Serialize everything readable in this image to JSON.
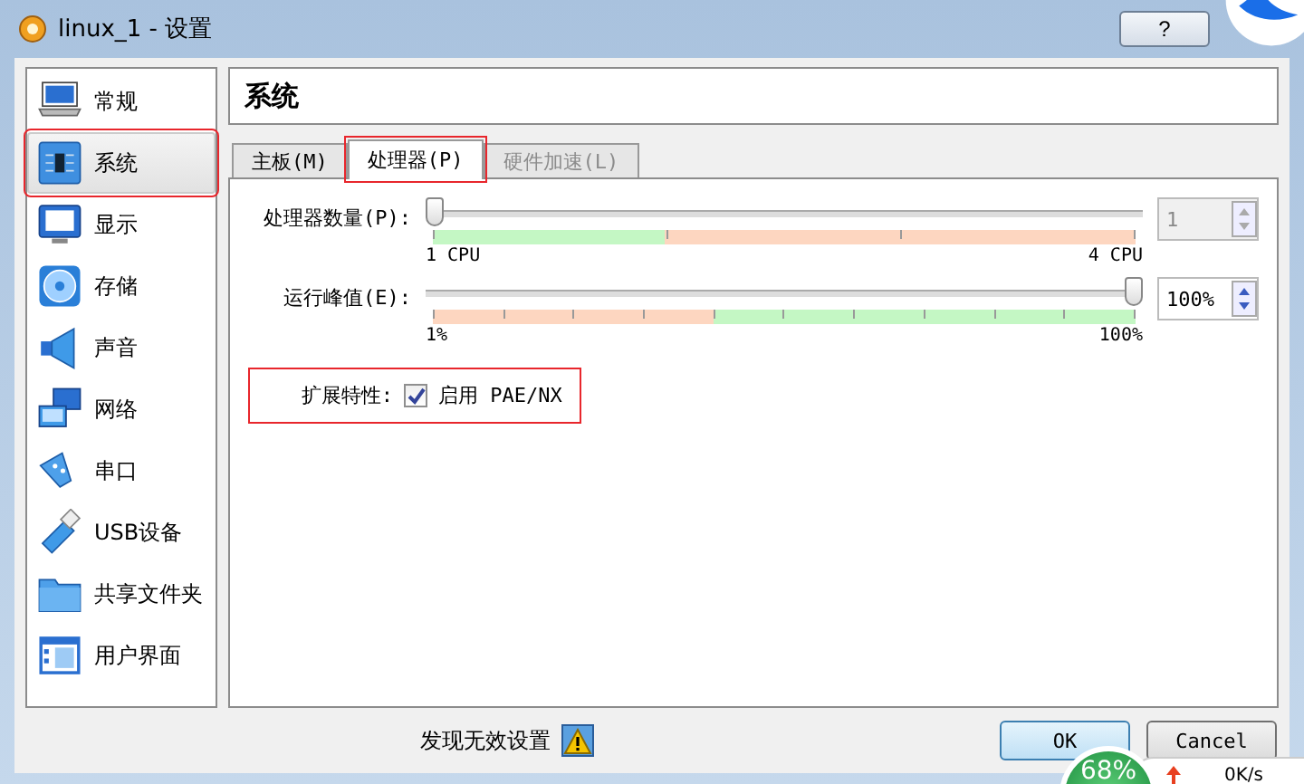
{
  "window": {
    "title": "linux_1 - 设置",
    "help": "?"
  },
  "sidebar": {
    "items": [
      {
        "label": "常规",
        "selected": false,
        "highlighted": false
      },
      {
        "label": "系统",
        "selected": true,
        "highlighted": true
      },
      {
        "label": "显示",
        "selected": false,
        "highlighted": false
      },
      {
        "label": "存储",
        "selected": false,
        "highlighted": false
      },
      {
        "label": "声音",
        "selected": false,
        "highlighted": false
      },
      {
        "label": "网络",
        "selected": false,
        "highlighted": false
      },
      {
        "label": "串口",
        "selected": false,
        "highlighted": false
      },
      {
        "label": "USB设备",
        "selected": false,
        "highlighted": false
      },
      {
        "label": "共享文件夹",
        "selected": false,
        "highlighted": false
      },
      {
        "label": "用户界面",
        "selected": false,
        "highlighted": false
      }
    ]
  },
  "page_title": "系统",
  "tabs": [
    {
      "label": "主板(M)",
      "selected": false,
      "disabled": false,
      "highlighted": false
    },
    {
      "label": "处理器(P)",
      "selected": true,
      "disabled": false,
      "highlighted": true
    },
    {
      "label": "硬件加速(L)",
      "selected": false,
      "disabled": true,
      "highlighted": false
    }
  ],
  "sliders": [
    {
      "label": "处理器数量(P):",
      "level": 0,
      "min_label": "1 CPU",
      "max_label": "4 CPU",
      "green_first": true,
      "value": "1",
      "disabled": true
    },
    {
      "label": "运行峰值(E):",
      "level": 1,
      "min_label": "1%",
      "max_label": "100%",
      "green_first": false,
      "value": "100%",
      "disabled": false
    }
  ],
  "extended": {
    "label": "扩展特性:",
    "option": "启用 PAE/NX",
    "checked": true,
    "highlighted": true
  },
  "footer": {
    "warning": "发现无效设置",
    "buttons": [
      {
        "label": "OK",
        "default": true
      },
      {
        "label": "Cancel",
        "default": false
      }
    ]
  },
  "monitor_widget": {
    "percent": "68%",
    "speed": "0K/s"
  }
}
